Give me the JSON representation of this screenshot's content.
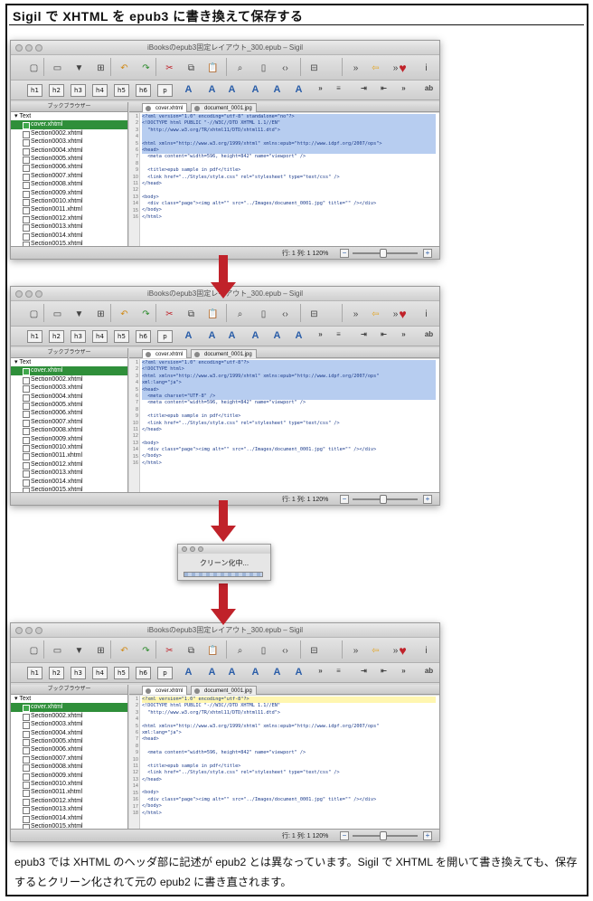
{
  "page": {
    "title": "Sigil で XHTML を epub3 に書き換えて保存する",
    "caption": "epub3 では XHTML のヘッダ部に記述が epub2 とは異なっています。Sigil で XHTML を開いて書き換えても、保存するとクリーン化されて元の epub2 に書き直されます。"
  },
  "window": {
    "title": "iBooksのepub3固定レイアウト_300.epub – Sigil",
    "heading_buttons": [
      "h1",
      "h2",
      "h3",
      "h4",
      "h5",
      "h6",
      "p"
    ],
    "panel_title": "ブックブラウザー",
    "tree_root": "Text",
    "files": [
      "cover.xhtml",
      "Section0002.xhtml",
      "Section0003.xhtml",
      "Section0004.xhtml",
      "Section0005.xhtml",
      "Section0006.xhtml",
      "Section0007.xhtml",
      "Section0008.xhtml",
      "Section0009.xhtml",
      "Section0010.xhtml",
      "Section0011.xhtml",
      "Section0012.xhtml",
      "Section0013.xhtml",
      "Section0014.xhtml",
      "Section0015.xhtml"
    ],
    "tabs": [
      "cover.xhtml",
      "document_0001.jpg"
    ],
    "status": "行: 1 列: 1  120%"
  },
  "screens": [
    {
      "lines": [
        "<?xml version=\"1.0\" encoding=\"utf-8\" standalone=\"no\"?>",
        "<!DOCTYPE html PUBLIC \"-//W3C//DTD XHTML 1.1//EN\"",
        "  \"http://www.w3.org/TR/xhtml11/DTD/xhtml11.dtd\">",
        "",
        "<html xmlns=\"http://www.w3.org/1999/xhtml\" xmlns:epub=\"http://www.idpf.org/2007/ops\">",
        "<head>",
        "  <meta content=\"width=596, height=842\" name=\"viewport\" />",
        "",
        "  <title>epub sample in pdf</title>",
        "  <link href=\"../Styles/style.css\" rel=\"stylesheet\" type=\"text/css\" />",
        "</head>",
        "",
        "<body>",
        "  <div class=\"page\"><img alt=\"\" src=\"../Images/document_0001.jpg\" title=\"\" /></div>",
        "</body>",
        "</html>"
      ]
    },
    {
      "lines": [
        "<?xml version=\"1.0\" encoding=\"utf-8\"?>",
        "<!DOCTYPE html>",
        "<html xmlns=\"http://www.w3.org/1999/xhtml\" xmlns:epub=\"http://www.idpf.org/2007/ops\"",
        "xml:lang=\"ja\">",
        "<head>",
        "  <meta charset=\"UTF-8\" />",
        "  <meta content=\"width=596, height=842\" name=\"viewport\" />",
        "",
        "  <title>epub sample in pdf</title>",
        "  <link href=\"../Styles/style.css\" rel=\"stylesheet\" type=\"text/css\" />",
        "</head>",
        "",
        "<body>",
        "  <div class=\"page\"><img alt=\"\" src=\"../Images/document_0001.jpg\" title=\"\" /></div>",
        "</body>",
        "</html>"
      ]
    },
    {
      "lines": [
        "<?xml version=\"1.0\" encoding=\"utf-8\"?>",
        "<!DOCTYPE html PUBLIC \"-//W3C//DTD XHTML 1.1//EN\"",
        "  \"http://www.w3.org/TR/xhtml11/DTD/xhtml11.dtd\">",
        "",
        "<html xmlns=\"http://www.w3.org/1999/xhtml\" xmlns:epub=\"http://www.idpf.org/2007/ops\"",
        "xml:lang=\"ja\">",
        "<head>",
        "",
        "  <meta content=\"width=596, height=842\" name=\"viewport\" />",
        "",
        "  <title>epub sample in pdf</title>",
        "  <link href=\"../Styles/style.css\" rel=\"stylesheet\" type=\"text/css\" />",
        "</head>",
        "",
        "<body>",
        "  <div class=\"page\"><img alt=\"\" src=\"../Images/document_0001.jpg\" title=\"\" /></div>",
        "</body>",
        "</html>"
      ]
    }
  ],
  "dialog": {
    "message": "クリーン化中..."
  },
  "colors": {
    "arrow": "#c0222a",
    "selection": "#2f8f3a",
    "highlight": "#b7cdf0"
  }
}
